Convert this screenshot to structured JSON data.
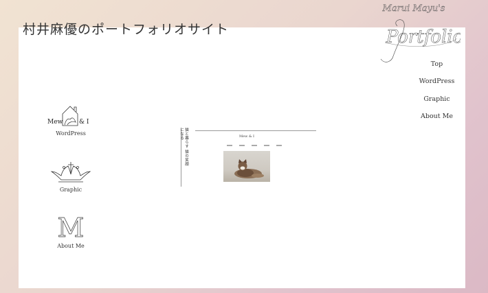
{
  "site": {
    "title": "村井麻優のポートフォリオサイト",
    "logo_text_top": "Marui Mayu's",
    "logo_text_main": "Portfolio"
  },
  "nav": {
    "items": [
      {
        "label": "Top"
      },
      {
        "label": "WordPress"
      },
      {
        "label": "Graphic"
      },
      {
        "label": "About Me"
      }
    ]
  },
  "works": [
    {
      "label": "WordPress",
      "icon": "mew-and-i-logo-icon",
      "logo_text_left": "Mew",
      "logo_text_right": "& I"
    },
    {
      "label": "Graphic",
      "icon": "crown-icon"
    },
    {
      "label": "About Me",
      "icon": "monogram-m-icon",
      "letter": "M"
    }
  ],
  "preview": {
    "vertical_text": "猫と暮らす 猫の笑顔になる",
    "mini_logo": "Mew & I"
  },
  "colors": {
    "background_start": "#f1e3d2",
    "background_end": "#dbb9c5",
    "panel": "#ffffff",
    "text": "#333333"
  }
}
